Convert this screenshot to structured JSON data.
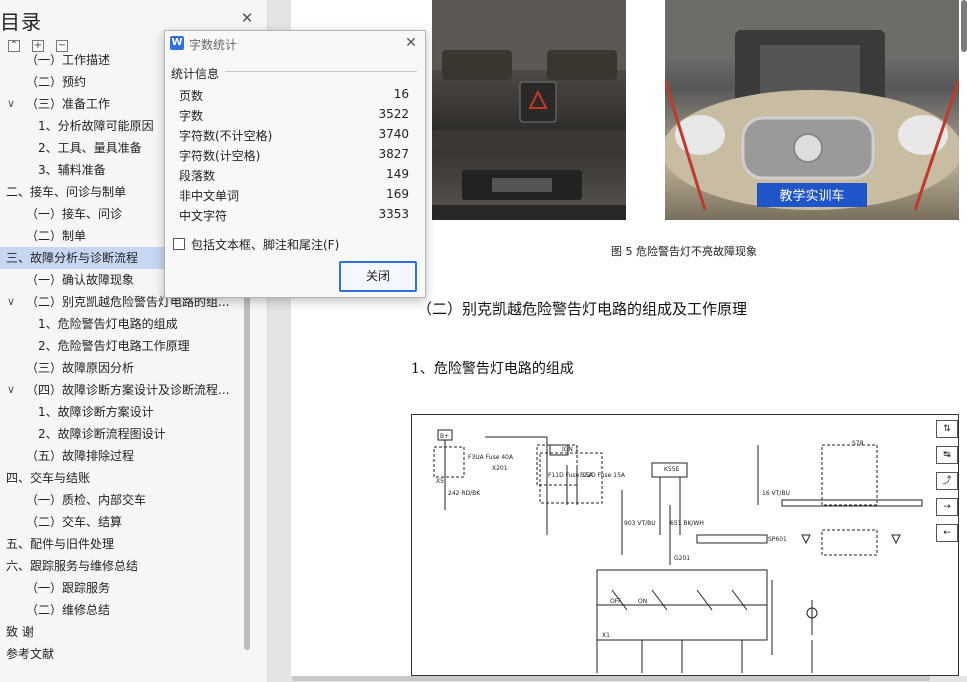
{
  "toc": {
    "title": "目录",
    "items": [
      {
        "label": "（一）工作描述",
        "indent": 1,
        "chevron": "",
        "selected": false
      },
      {
        "label": "（二）预约",
        "indent": 1,
        "chevron": "",
        "selected": false
      },
      {
        "label": "（三）准备工作",
        "indent": 1,
        "chevron": "∨",
        "selected": false
      },
      {
        "label": "1、分析故障可能原因",
        "indent": 2,
        "chevron": "",
        "selected": false
      },
      {
        "label": "2、工具、量具准备",
        "indent": 2,
        "chevron": "",
        "selected": false
      },
      {
        "label": "3、辅料准备",
        "indent": 2,
        "chevron": "",
        "selected": false
      },
      {
        "label": "二、接车、问诊与制单",
        "indent": 0,
        "chevron": "",
        "selected": false
      },
      {
        "label": "（一）接车、问诊",
        "indent": 1,
        "chevron": "",
        "selected": false
      },
      {
        "label": "（二）制单",
        "indent": 1,
        "chevron": "",
        "selected": false
      },
      {
        "label": "三、故障分析与诊断流程",
        "indent": 0,
        "chevron": "",
        "selected": true
      },
      {
        "label": "（一）确认故障现象",
        "indent": 1,
        "chevron": "",
        "selected": false
      },
      {
        "label": "（二）别克凯越危险警告灯电路的组...",
        "indent": 1,
        "chevron": "∨",
        "selected": false
      },
      {
        "label": "1、危险警告灯电路的组成",
        "indent": 2,
        "chevron": "",
        "selected": false
      },
      {
        "label": "2、危险警告灯电路工作原理",
        "indent": 2,
        "chevron": "",
        "selected": false
      },
      {
        "label": "（三）故障原因分析",
        "indent": 1,
        "chevron": "",
        "selected": false
      },
      {
        "label": "（四）故障诊断方案设计及诊断流程...",
        "indent": 1,
        "chevron": "∨",
        "selected": false
      },
      {
        "label": "1、故障诊断方案设计",
        "indent": 2,
        "chevron": "",
        "selected": false
      },
      {
        "label": "2、故障诊断流程图设计",
        "indent": 2,
        "chevron": "",
        "selected": false
      },
      {
        "label": "（五）故障排除过程",
        "indent": 1,
        "chevron": "",
        "selected": false
      },
      {
        "label": "四、交车与结账",
        "indent": 0,
        "chevron": "",
        "selected": false
      },
      {
        "label": "（一）质检、内部交车",
        "indent": 1,
        "chevron": "",
        "selected": false
      },
      {
        "label": "（二）交车、结算",
        "indent": 1,
        "chevron": "",
        "selected": false
      },
      {
        "label": "五、配件与旧件处理",
        "indent": 0,
        "chevron": "",
        "selected": false
      },
      {
        "label": "六、跟踪服务与维修总结",
        "indent": 0,
        "chevron": "",
        "selected": false
      },
      {
        "label": "（一）跟踪服务",
        "indent": 1,
        "chevron": "",
        "selected": false
      },
      {
        "label": "（二）维修总结",
        "indent": 1,
        "chevron": "",
        "selected": false
      },
      {
        "label": "致 谢",
        "indent": 0,
        "chevron": "",
        "selected": false
      },
      {
        "label": "参考文献",
        "indent": 0,
        "chevron": "",
        "selected": false
      }
    ]
  },
  "document": {
    "photo_badge": "教学实训车",
    "figure_caption": "图 5 危险警告灯不亮故障现象",
    "section_heading": "（二）别克凯越危险警告灯电路的组成及工作原理",
    "sub_heading": "1、危险警告灯电路的组成",
    "diagram_labels": [
      "B+",
      "F3UA Fuse 40A",
      "X5",
      "242 RD/BK",
      "X201",
      "IGN 1",
      "F11D Fuse 15A",
      "F22D Fuse 15A",
      "K55E",
      "903 VT/BU",
      "651 BK/WH",
      "G201",
      "16 VT/BU",
      "SP601",
      "S78",
      "OFF",
      "ON",
      "X1"
    ]
  },
  "word_count": {
    "title": "字数统计",
    "group_label": "统计信息",
    "stats": [
      {
        "label": "页数",
        "value": "16"
      },
      {
        "label": "字数",
        "value": "3522"
      },
      {
        "label": "字符数(不计空格)",
        "value": "3740"
      },
      {
        "label": "字符数(计空格)",
        "value": "3827"
      },
      {
        "label": "段落数",
        "value": "149"
      },
      {
        "label": "非中文单词",
        "value": "169"
      },
      {
        "label": "中文字符",
        "value": "3353"
      }
    ],
    "checkbox_label": "包括文本框、脚注和尾注(F)",
    "checkbox_checked": false,
    "close_button": "关闭"
  },
  "colors": {
    "accent": "#2f6fe0",
    "selection": "#c7d7f1"
  }
}
